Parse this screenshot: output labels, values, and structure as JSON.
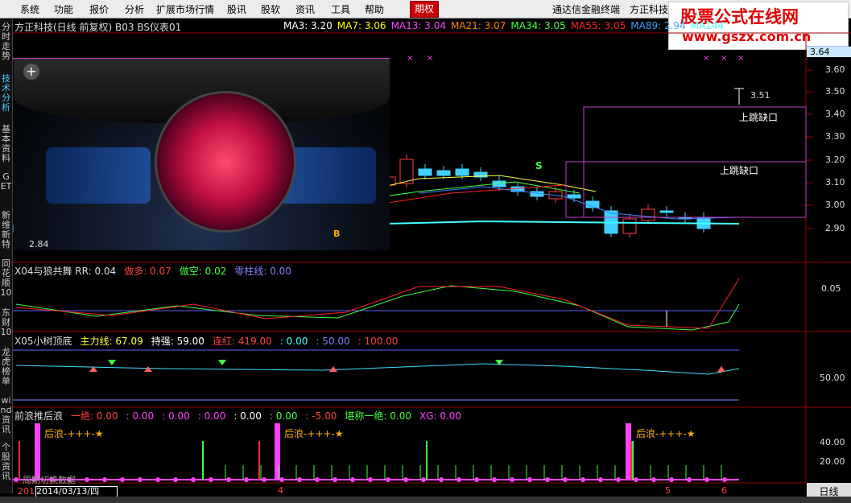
{
  "menu": [
    "系统",
    "功能",
    "报价",
    "分析",
    "扩展市场行情",
    "股讯",
    "股软",
    "资讯",
    "工具",
    "帮助",
    "期权"
  ],
  "menu_right": [
    "通达信金融终端",
    "方正科技"
  ],
  "watermark": {
    "line1": "股票公式在线网",
    "line2": "www.gszx.com.cn"
  },
  "left_tabs": [
    "分时走势",
    "技术分析",
    "基本资料",
    "GET",
    "新维新特",
    "同花顺10",
    "东财10",
    "龙虎榜单",
    "wind资讯",
    "个股资讯"
  ],
  "main_header": {
    "title": "方正科技(日线 前复权) B03 BS仪表01",
    "ma": [
      {
        "label": "MA3: 3.20",
        "color": "#ffffff"
      },
      {
        "label": "MA7: 3.06",
        "color": "#ffff00"
      },
      {
        "label": "MA13: 3.04",
        "color": "#ff40ff"
      },
      {
        "label": "MA21: 3.07",
        "color": "#ff8000"
      },
      {
        "label": "MA34: 3.05",
        "color": "#40ff40"
      },
      {
        "label": "MA55: 3.05",
        "color": "#ff2020"
      },
      {
        "label": "MA89: 2.94",
        "color": "#40a0ff"
      },
      {
        "label": "MA144",
        "color": "#40ffff"
      }
    ]
  },
  "price_axis": [
    "3.64",
    "3.60",
    "3.50",
    "3.40",
    "3.30",
    "3.20",
    "3.10",
    "3.00",
    "2.90"
  ],
  "annotations": {
    "high": "3.51",
    "low": "2.84",
    "gap1": "上跳缺口",
    "gap2": "上跳缺口",
    "buy": "B",
    "sell": "S"
  },
  "panel2": {
    "items": [
      {
        "text": "X04与狼共舞 RR: 0.04",
        "color": "#dddddd"
      },
      {
        "text": "做多: 0.07",
        "color": "#ff4040"
      },
      {
        "text": "做空: 0.02",
        "color": "#40ff40"
      },
      {
        "text": "零柱线: 0.00",
        "color": "#8080ff"
      }
    ],
    "axis": [
      "0.05"
    ]
  },
  "panel3": {
    "items": [
      {
        "text": "X05小树顶底",
        "color": "#dddddd"
      },
      {
        "text": "主力线: 67.09",
        "color": "#ffff40"
      },
      {
        "text": "持强: 59.00",
        "color": "#ffffff"
      },
      {
        "text": "连红: 419.00",
        "color": "#ff4040"
      },
      {
        "text": ": 0.00",
        "color": "#40ffff"
      },
      {
        "text": ": 50.00",
        "color": "#8080ff"
      },
      {
        "text": ": 100.00",
        "color": "#ff4040"
      }
    ],
    "axis": [
      "50.00"
    ]
  },
  "panel4": {
    "items": [
      {
        "text": "前浪推后浪",
        "color": "#dddddd"
      },
      {
        "text": "一绝: 0.00",
        "color": "#ff4040"
      },
      {
        "text": ": 0.00",
        "color": "#ff40ff"
      },
      {
        "text": ": 0.00",
        "color": "#ff40ff"
      },
      {
        "text": ": 0.00",
        "color": "#ff40ff"
      },
      {
        "text": ": 0.00",
        "color": "#ffffff"
      },
      {
        "text": ": 0.00",
        "color": "#40ff40"
      },
      {
        "text": ": -5.00",
        "color": "#ff4040"
      },
      {
        "text": "堪称一绝: 0.00",
        "color": "#40ff40"
      },
      {
        "text": "XG: 0.00",
        "color": "#ff40ff"
      }
    ],
    "label": "后浪-+++-★",
    "axis": [
      "40.00",
      "20.00"
    ],
    "bottom_text": "周期切换数据"
  },
  "time_axis": {
    "left": "201",
    "date": "2014/03/13/四",
    "marks": [
      "4",
      "5",
      "6"
    ]
  },
  "day_button": "日线"
}
